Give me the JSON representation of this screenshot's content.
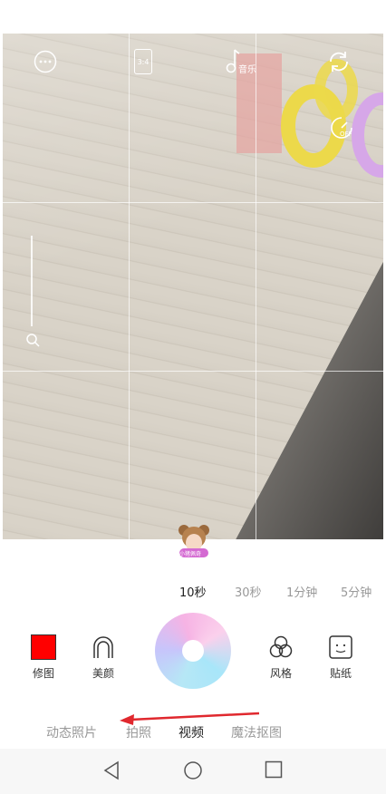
{
  "top_controls": {
    "more": "more-dots-icon",
    "ratio_label": "3:4",
    "music_label": "音乐",
    "flip": "camera-flip-icon",
    "timer_label": "OFF"
  },
  "sticker": {
    "text": "小猪佩奇"
  },
  "durations": [
    {
      "label": "10秒",
      "active": true
    },
    {
      "label": "30秒",
      "active": false
    },
    {
      "label": "1分钟",
      "active": false
    },
    {
      "label": "5分钟",
      "active": false
    }
  ],
  "tools": {
    "edit": "修图",
    "beauty": "美颜",
    "style": "风格",
    "stickers": "贴纸"
  },
  "modes": [
    {
      "label": "动态照片",
      "active": false
    },
    {
      "label": "拍照",
      "active": false
    },
    {
      "label": "视频",
      "active": true
    },
    {
      "label": "魔法抠图",
      "active": false
    }
  ],
  "colors": {
    "edit_swatch": "#ff0000",
    "annotation_arrow": "#e0282e"
  }
}
